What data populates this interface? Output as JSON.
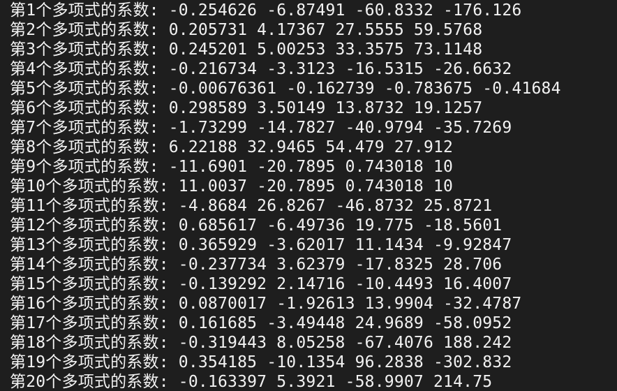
{
  "terminal": {
    "lines": [
      "第1个多项式的系数: -0.254626 -6.87491 -60.8332 -176.126",
      "第2个多项式的系数: 0.205731 4.17367 27.5555 59.5768",
      "第3个多项式的系数: 0.245201 5.00253 33.3575 73.1148",
      "第4个多项式的系数: -0.216734 -3.3123 -16.5315 -26.6632",
      "第5个多项式的系数: -0.00676361 -0.162739 -0.783675 -0.41684",
      "第6个多项式的系数: 0.298589 3.50149 13.8732 19.1257",
      "第7个多项式的系数: -1.73299 -14.7827 -40.9794 -35.7269",
      "第8个多项式的系数: 6.22188 32.9465 54.479 27.912",
      "第9个多项式的系数: -11.6901 -20.7895 0.743018 10",
      "第10个多项式的系数: 11.0037 -20.7895 0.743018 10",
      "第11个多项式的系数: -4.8684 26.8267 -46.8732 25.8721",
      "第12个多项式的系数: 0.685617 -6.49736 19.775 -18.5601",
      "第13个多项式的系数: 0.365929 -3.62017 11.1434 -9.92847",
      "第14个多项式的系数: -0.237734 3.62379 -17.8325 28.706",
      "第15个多项式的系数: -0.139292 2.14716 -10.4493 16.4007",
      "第16个多项式的系数: 0.0870017 -1.92613 13.9904 -32.4787",
      "第17个多项式的系数: 0.161685 -3.49448 24.9689 -58.0952",
      "第18个多项式的系数: -0.319443 8.05258 -67.4076 188.242",
      "第19个多项式的系数: 0.354185 -10.1354 96.2838 -302.832",
      "第20个多项式的系数: -0.163397 5.3921 -58.9907 214.75"
    ]
  }
}
